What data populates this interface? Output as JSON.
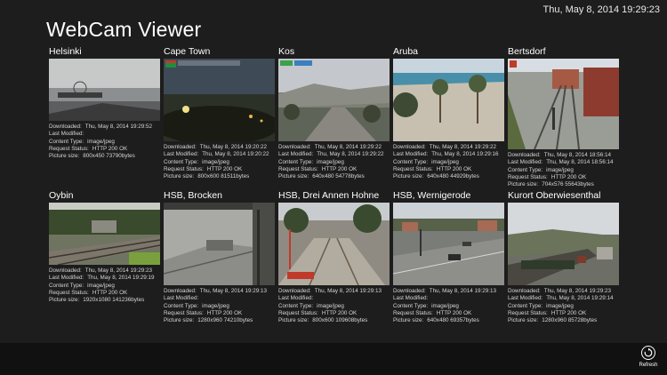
{
  "header": {
    "datetime": "Thu, May 8, 2014 19:29:23",
    "app_title": "WebCam Viewer"
  },
  "labels": {
    "downloaded": "Downloaded:",
    "last_modified": "Last Modified:",
    "content_type": "Content Type:",
    "request_status": "Request Status:",
    "picture_size": "Picture size:"
  },
  "webcams": [
    {
      "name": "Helsinki",
      "downloaded": "Thu, May 8, 2014 19:29:52",
      "last_modified": "",
      "content_type": "image/jpeg",
      "request_status": "HTTP 200 OK",
      "picture_size": "800x450  73790bytes"
    },
    {
      "name": "Cape Town",
      "downloaded": "Thu, May 8, 2014 19:20:22",
      "last_modified": "Thu, May 8, 2014 19:20:22",
      "content_type": "image/jpeg",
      "request_status": "HTTP 200 OK",
      "picture_size": "800x600  81511bytes"
    },
    {
      "name": "Kos",
      "downloaded": "Thu, May 8, 2014 19:29:22",
      "last_modified": "Thu, May 8, 2014 19:29:22",
      "content_type": "image/jpeg",
      "request_status": "HTTP 200 OK",
      "picture_size": "640x480  54778bytes"
    },
    {
      "name": "Aruba",
      "downloaded": "Thu, May 8, 2014 19:29:22",
      "last_modified": "Thu, May 8, 2014 19:29:16",
      "content_type": "image/jpeg",
      "request_status": "HTTP 200 OK",
      "picture_size": "640x480  44929bytes"
    },
    {
      "name": "Bertsdorf",
      "downloaded": "Thu, May 8, 2014 18:56:14",
      "last_modified": "Thu, May 8, 2014 18:56:14",
      "content_type": "image/jpeg",
      "request_status": "HTTP 200 OK",
      "picture_size": "704x576  55643bytes"
    },
    {
      "name": "Oybin",
      "downloaded": "Thu, May 8, 2014 19:29:23",
      "last_modified": "Thu, May 8, 2014 19:29:19",
      "content_type": "image/jpeg",
      "request_status": "HTTP 200 OK",
      "picture_size": "1920x1080  141236bytes"
    },
    {
      "name": "HSB, Brocken",
      "downloaded": "Thu, May 8, 2014 19:29:13",
      "last_modified": "",
      "content_type": "image/jpeg",
      "request_status": "HTTP 200 OK",
      "picture_size": "1280x960  74210bytes"
    },
    {
      "name": "HSB, Drei Annen Hohne",
      "downloaded": "Thu, May 8, 2014 19:29:13",
      "last_modified": "",
      "content_type": "image/jpeg",
      "request_status": "HTTP 200 OK",
      "picture_size": "800x600  109608bytes"
    },
    {
      "name": "HSB, Wernigerode",
      "downloaded": "Thu, May 8, 2014 19:29:13",
      "last_modified": "",
      "content_type": "image/jpeg",
      "request_status": "HTTP 200 OK",
      "picture_size": "640x480  69357bytes"
    },
    {
      "name": "Kurort Oberwiesenthal",
      "downloaded": "Thu, May 8, 2014 19:29:23",
      "last_modified": "Thu, May 8, 2014 19:29:14",
      "content_type": "image/jpeg",
      "request_status": "HTTP 200 OK",
      "picture_size": "1280x960  85728bytes"
    }
  ],
  "appbar": {
    "refresh_label": "Refresh",
    "refresh_icon": "refresh-icon"
  }
}
